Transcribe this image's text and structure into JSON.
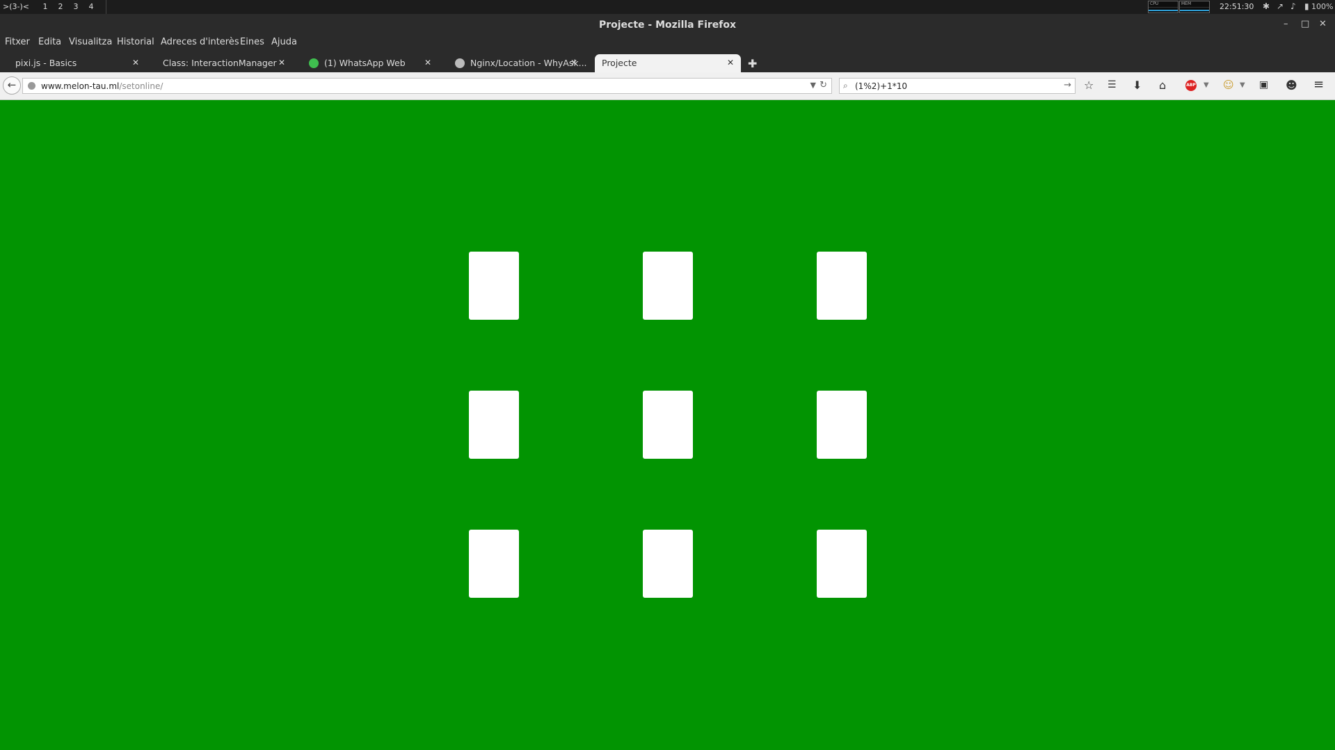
{
  "desktop": {
    "launcher": ">(3-)<",
    "workspaces": [
      "1",
      "2",
      "3",
      "4"
    ],
    "active_workspace": "1",
    "cpu_label": "CPU",
    "mem_label": "MEM",
    "clock": "22:51:30",
    "battery": "100%"
  },
  "window": {
    "title": "Projecte - Mozilla Firefox"
  },
  "menu": [
    "Fitxer",
    "Edita",
    "Visualitza",
    "Historial",
    "Adreces d'interès",
    "Eines",
    "Ajuda"
  ],
  "tabs": [
    {
      "label": "pixi.js - Basics",
      "active": false
    },
    {
      "label": "Class: InteractionManager",
      "active": false
    },
    {
      "label": "(1) WhatsApp Web",
      "active": false,
      "icon": "whatsapp-icon"
    },
    {
      "label": "Nginx/Location - WhyAsk...",
      "active": false,
      "icon": "globe-icon"
    },
    {
      "label": "Projecte",
      "active": true
    }
  ],
  "url": {
    "domain": "www.melon-tau.ml",
    "path": "/setonline/"
  },
  "search": {
    "value": "(1%2)+1*10"
  },
  "content": {
    "background": "#029402",
    "card_color": "#ffffff",
    "cards": [
      "",
      "",
      "",
      "",
      "",
      "",
      "",
      "",
      ""
    ]
  },
  "colors": {
    "abp": "#dd2222"
  }
}
